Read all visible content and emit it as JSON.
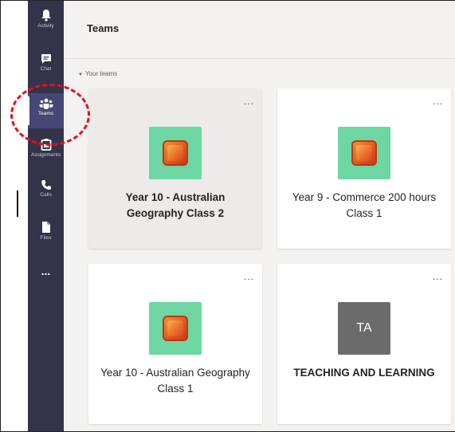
{
  "rail": {
    "items": [
      {
        "label": "Activity"
      },
      {
        "label": "Chat"
      },
      {
        "label": "Teams"
      },
      {
        "label": "Assignments"
      },
      {
        "label": "Calls"
      },
      {
        "label": "Files"
      },
      {
        "label": "..."
      }
    ]
  },
  "header": {
    "title": "Teams"
  },
  "section": {
    "label": "Your teams"
  },
  "teams": [
    {
      "name": "Year 10 - Australian Geography Class 2",
      "more": "...",
      "tile": "office-app-icon"
    },
    {
      "name": "Year 9 - Commerce 200 hours Class 1",
      "more": "...",
      "tile": "office-app-icon"
    },
    {
      "name": "Year 10 - Australian Geography Class 1",
      "more": "...",
      "tile": "office-app-icon"
    },
    {
      "name": "TEACHING AND LEARNING",
      "more": "...",
      "initials": "TA"
    }
  ],
  "colors": {
    "rail_bg": "#33344a",
    "rail_active": "#464775",
    "tile_green": "#6dd6a3",
    "tile_gray": "#6b6b6b",
    "highlight_red": "#e3101c",
    "main_bg": "#f3f2f1"
  }
}
